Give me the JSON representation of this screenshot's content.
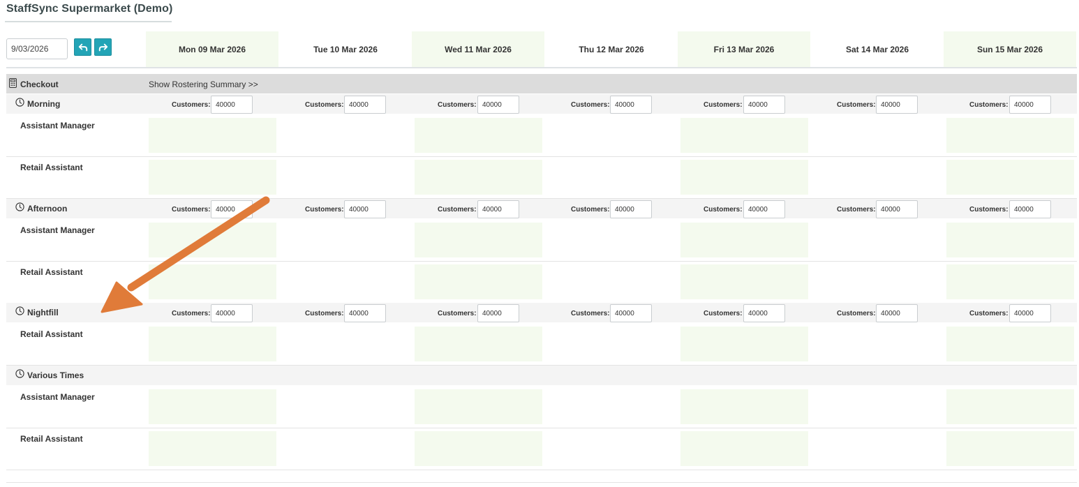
{
  "app": {
    "title": "StaffSync Supermarket (Demo)"
  },
  "toolbar": {
    "date_value": "9/03/2026",
    "undo_icon": "undo-arrow-icon",
    "redo_icon": "redo-arrow-icon"
  },
  "days": [
    "Mon 09 Mar 2026",
    "Tue 10 Mar 2026",
    "Wed 11 Mar 2026",
    "Thu 12 Mar 2026",
    "Fri 13 Mar 2026",
    "Sat 14 Mar 2026",
    "Sun 15 Mar 2026"
  ],
  "section": {
    "label": "Checkout",
    "icon": "calculator-icon",
    "summary_link": "Show Rostering Summary >>"
  },
  "customers_label": "Customers:",
  "shifts": [
    {
      "label": "Morning",
      "icon": "clock-icon",
      "customers": [
        "40000",
        "40000",
        "40000",
        "40000",
        "40000",
        "40000",
        "40000"
      ],
      "roles": [
        "Assistant Manager",
        "Retail Assistant"
      ]
    },
    {
      "label": "Afternoon",
      "icon": "clock-icon",
      "customers": [
        "40000",
        "40000",
        "40000",
        "40000",
        "40000",
        "40000",
        "40000"
      ],
      "roles": [
        "Assistant Manager",
        "Retail Assistant"
      ]
    },
    {
      "label": "Nightfill",
      "icon": "clock-icon",
      "customers": [
        "40000",
        "40000",
        "40000",
        "40000",
        "40000",
        "40000",
        "40000"
      ],
      "roles": [
        "Retail Assistant"
      ]
    },
    {
      "label": "Various Times",
      "icon": "clock-icon",
      "customers": [],
      "roles": [
        "Assistant Manager",
        "Retail Assistant"
      ]
    }
  ],
  "colors": {
    "accent": "#23a4b6",
    "day_shade": "#f4faee",
    "section_bar": "#dcdcdc",
    "annotation_arrow": "#e07b39"
  }
}
